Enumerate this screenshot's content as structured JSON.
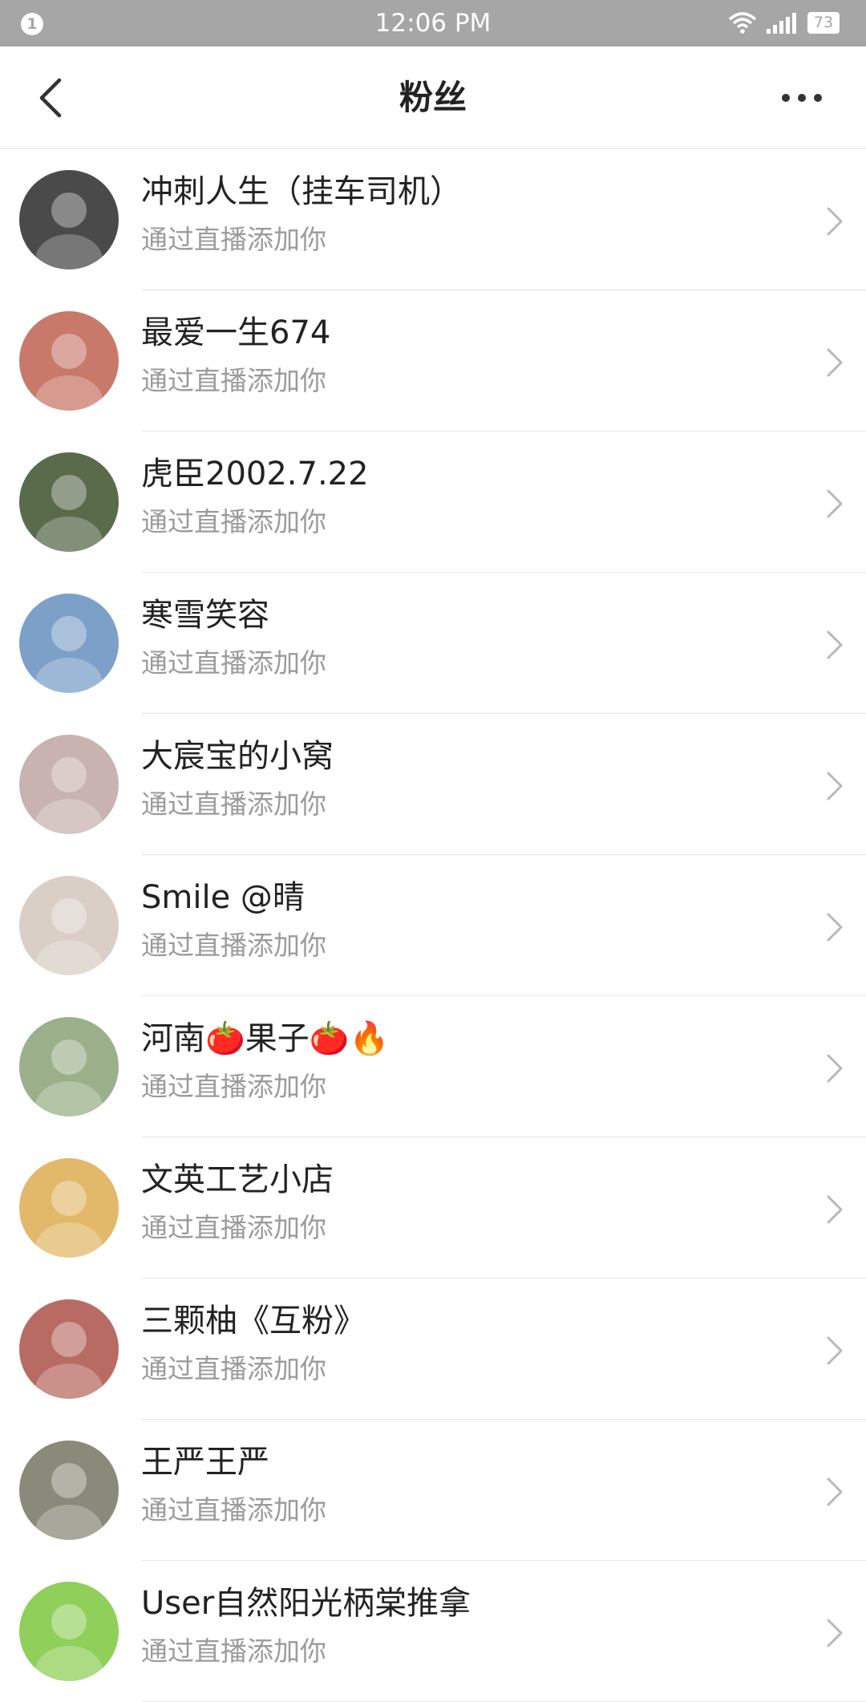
{
  "status_bar": {
    "notification_badge": "1",
    "time": "12:06 PM",
    "battery": "73"
  },
  "header": {
    "title": "粉丝",
    "back_icon": "back-arrow-icon",
    "more_icon": "more-dots-icon"
  },
  "fans": [
    {
      "name": "冲刺人生（挂车司机）",
      "subtitle": "通过直播添加你",
      "avatar_color": "#4a4a4a"
    },
    {
      "name": "最爱一生674",
      "subtitle": "通过直播添加你",
      "avatar_color": "#c8796a"
    },
    {
      "name": "虎臣2002.7.22",
      "subtitle": "通过直播添加你",
      "avatar_color": "#5a6b4c"
    },
    {
      "name": "寒雪笑容",
      "subtitle": "通过直播添加你",
      "avatar_color": "#7da0c9"
    },
    {
      "name": "大宸宝的小窝",
      "subtitle": "通过直播添加你",
      "avatar_color": "#c9b3b0"
    },
    {
      "name": "Smile @晴",
      "subtitle": "通过直播添加你",
      "avatar_color": "#d9cfc6"
    },
    {
      "name": "河南🍅果子🍅🔥",
      "subtitle": "通过直播添加你",
      "avatar_color": "#9ab08a"
    },
    {
      "name": "文英工艺小店",
      "subtitle": "通过直播添加你",
      "avatar_color": "#e2b86a"
    },
    {
      "name": "三颗柚《互粉》",
      "subtitle": "通过直播添加你",
      "avatar_color": "#b86b63"
    },
    {
      "name": "王严王严",
      "subtitle": "通过直播添加你",
      "avatar_color": "#8a8a7a"
    },
    {
      "name": "User自然阳光柄棠推拿",
      "subtitle": "通过直播添加你",
      "avatar_color": "#8fcf5a"
    }
  ]
}
